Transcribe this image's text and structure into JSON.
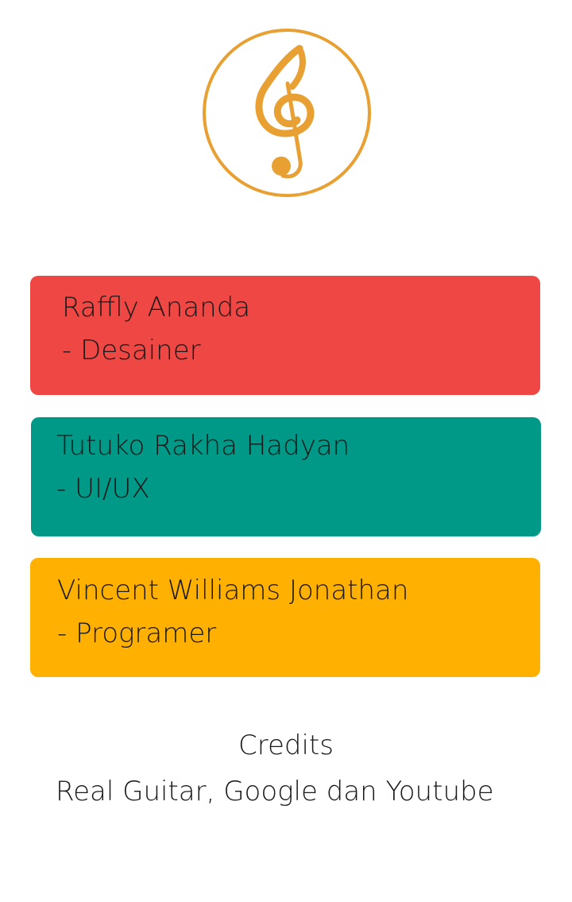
{
  "colors": {
    "accent": "#E8A033",
    "card_designer": "#EE4744",
    "card_uiux": "#009887",
    "card_programmer": "#FFB000",
    "text": "#1a1a1a",
    "background": "#FFFFFF"
  },
  "logo": {
    "icon": "treble-clef-icon"
  },
  "team": [
    {
      "name": "Raffly Ananda",
      "role": "- Desainer"
    },
    {
      "name": "Tutuko Rakha Hadyan",
      "role": "- UI/UX"
    },
    {
      "name": "Vincent Williams Jonathan",
      "role": "- Programer"
    }
  ],
  "credits": {
    "title": "Credits",
    "text": "Real Guitar, Google dan Youtube"
  }
}
